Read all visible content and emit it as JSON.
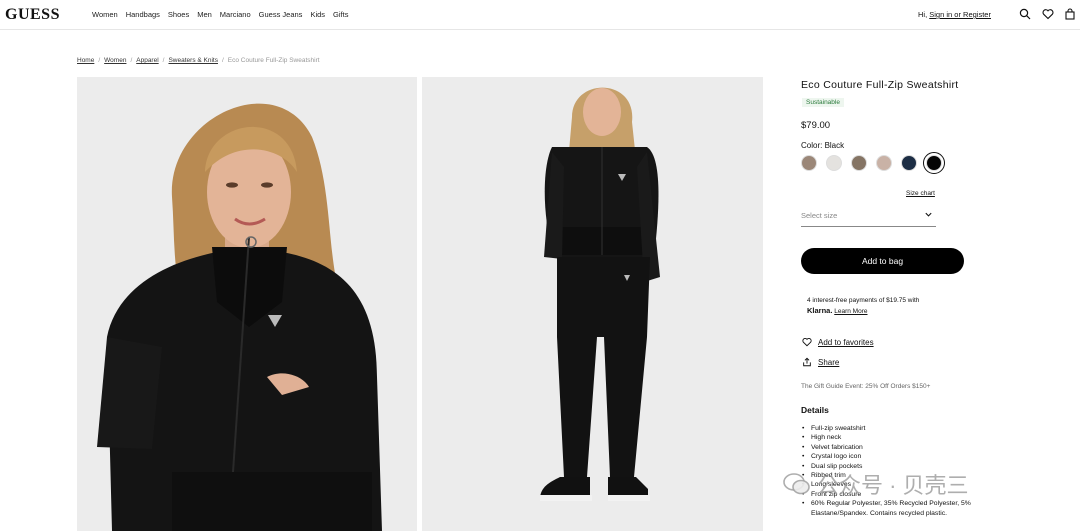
{
  "header": {
    "logo": "GUESS",
    "nav": [
      "Women",
      "Handbags",
      "Shoes",
      "Men",
      "Marciano",
      "Guess Jeans",
      "Kids",
      "Gifts"
    ],
    "greeting": "Hi,",
    "sign_in": "Sign in or Register"
  },
  "breadcrumb": [
    "Home",
    "Women",
    "Apparel",
    "Sweaters & Knits"
  ],
  "breadcrumb_current": "Eco Couture Full-Zip Sweatshirt",
  "breadcrumb_sep": "/",
  "product": {
    "title": "Eco Couture Full-Zip Sweatshirt",
    "tag": "Sustainable",
    "price": "$79.00",
    "color_label": "Color: Black",
    "swatches": [
      "#9b8778",
      "#e4e2df",
      "#857464",
      "#c9b2a6",
      "#1c2d44",
      "#050505"
    ],
    "selected_swatch_index": 5,
    "size_chart": "Size chart",
    "size_placeholder": "Select size",
    "add_to_bag": "Add to bag",
    "klarna_text": "4 interest-free payments of $19.75 with",
    "klarna_brand": "Klarna.",
    "klarna_learn": "Learn More",
    "favorites": "Add to favorites",
    "share": "Share",
    "promo": "The Gift Guide Event: 25% Off Orders $150+",
    "details_heading": "Details",
    "details": [
      "Full-zip sweatshirt",
      "High neck",
      "Velvet fabrication",
      "Crystal logo icon",
      "Dual slip pockets",
      "Ribbed trim",
      "Long sleeves",
      "Front zip closure",
      "60% Regular Polyester, 35% Recycled Polyester, 5% Elastane/Spandex. Contains recycled plastic."
    ]
  },
  "watermark": "公众号 · 贝壳三",
  "icons": {
    "search": "search-icon",
    "favorites": "heart-icon",
    "bag": "bag-icon",
    "share": "share-icon",
    "chevron": "chevron-down-icon"
  }
}
